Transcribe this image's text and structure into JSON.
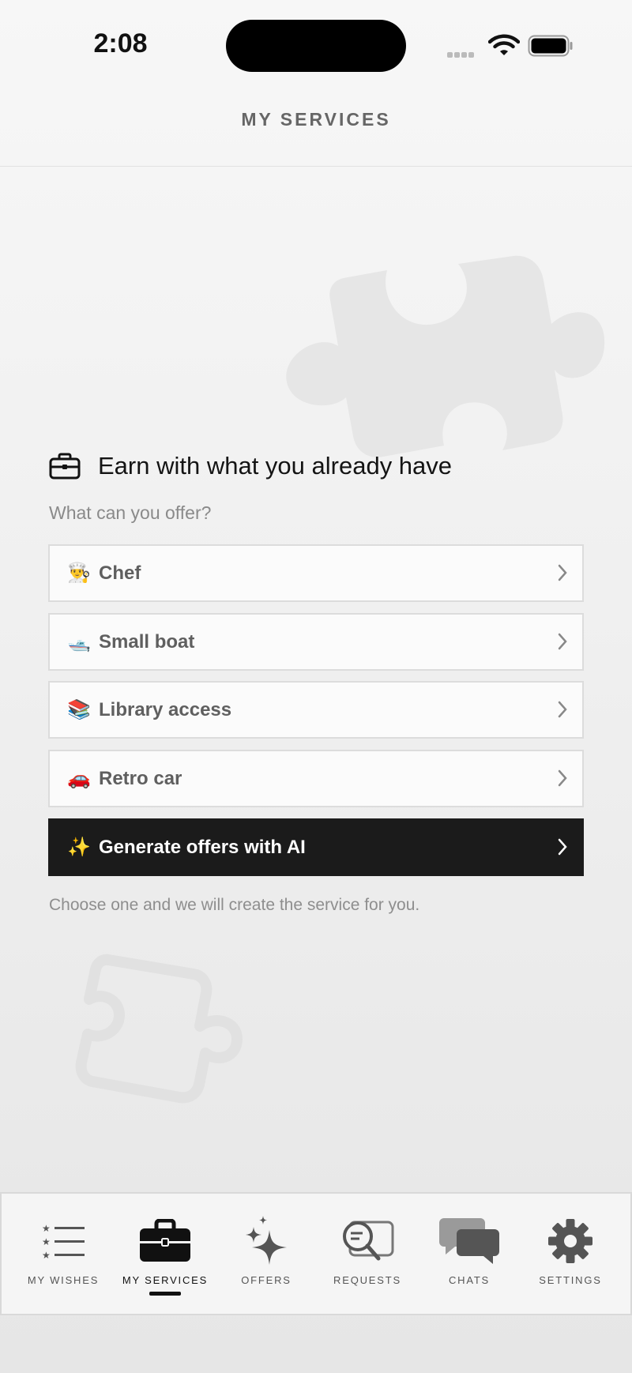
{
  "status_bar": {
    "time": "2:08"
  },
  "nav": {
    "title": "MY SERVICES"
  },
  "main": {
    "heading": "Earn with what you already have",
    "subheading": "What can you offer?",
    "options": [
      {
        "emoji": "👨‍🍳",
        "label": "Chef"
      },
      {
        "emoji": "🛥️",
        "label": "Small boat"
      },
      {
        "emoji": "📚",
        "label": "Library access"
      },
      {
        "emoji": "🚗",
        "label": "Retro car"
      }
    ],
    "ai_button": {
      "emoji": "✨",
      "label": "Generate offers with AI"
    },
    "hint": "Choose one and we will create the service for you."
  },
  "tabbar": {
    "tabs": [
      {
        "label": "MY WISHES",
        "icon": "list-stars-icon"
      },
      {
        "label": "MY SERVICES",
        "icon": "briefcase-icon",
        "active": true
      },
      {
        "label": "OFFERS",
        "icon": "sparkles-icon"
      },
      {
        "label": "REQUESTS",
        "icon": "search-document-icon"
      },
      {
        "label": "CHATS",
        "icon": "chat-bubbles-icon"
      },
      {
        "label": "SETTINGS",
        "icon": "gear-icon"
      }
    ]
  }
}
